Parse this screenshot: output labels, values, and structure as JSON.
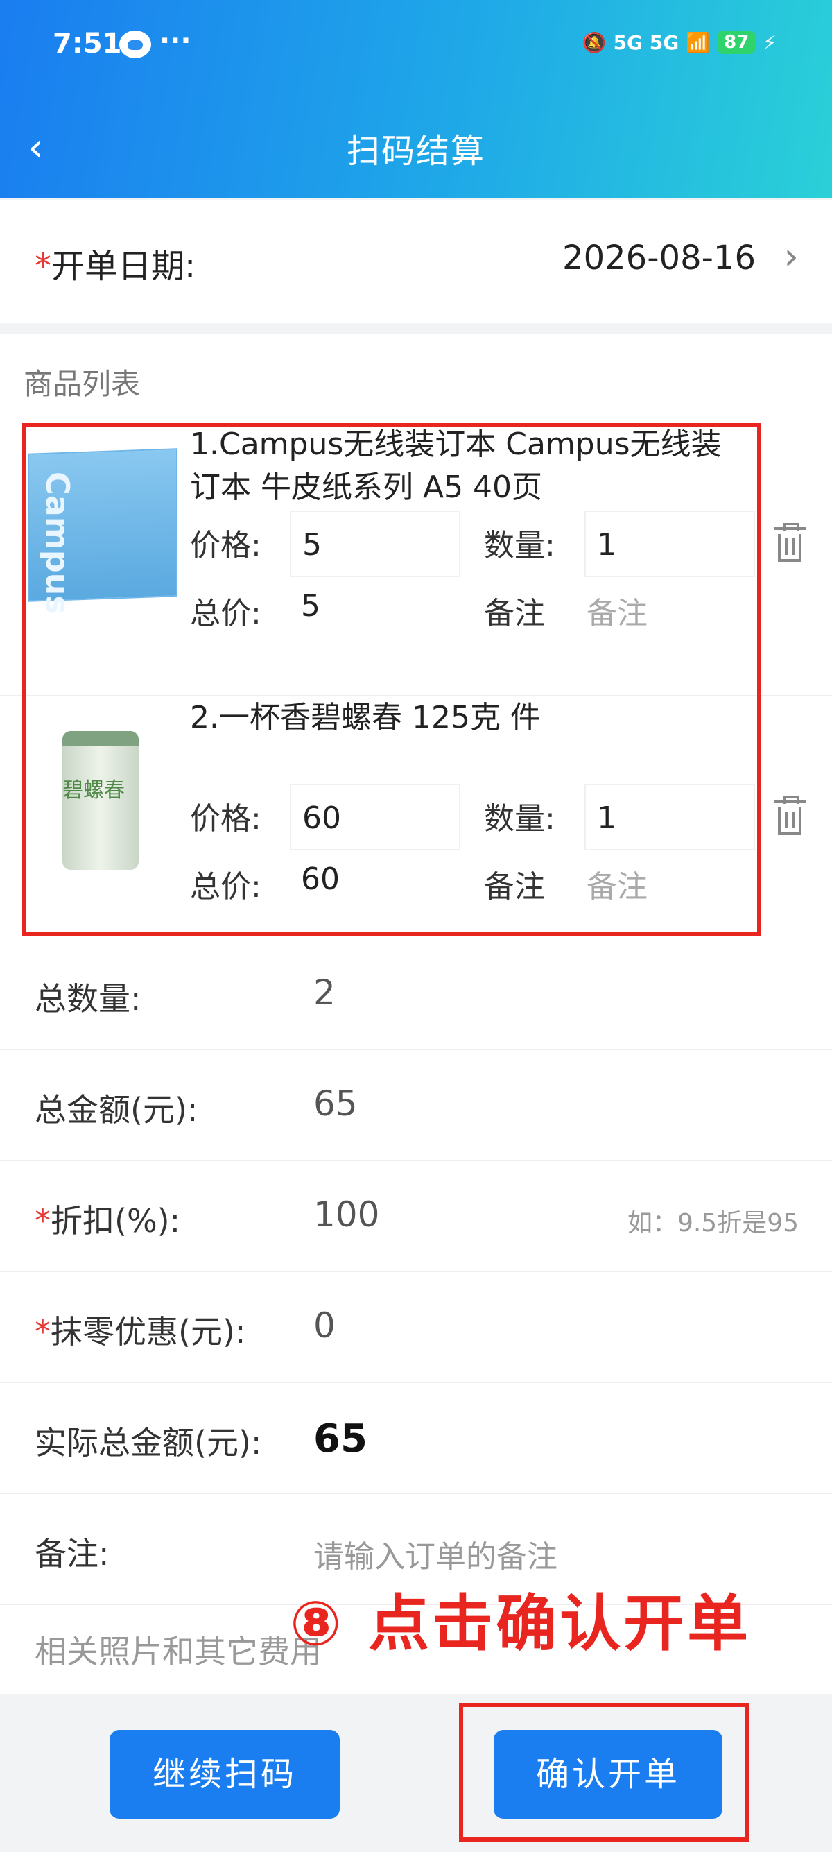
{
  "status_bar": {
    "time": "7:51",
    "dots": "···",
    "network": "5G 5G",
    "battery": "87"
  },
  "nav": {
    "back_icon": "chevron-left-icon",
    "title": "扫码结算"
  },
  "order_date": {
    "label": "开单日期:",
    "required_mark": "*",
    "value": "2026-08-16"
  },
  "goods": {
    "section_title": "商品列表",
    "price_label": "价格:",
    "qty_label": "数量:",
    "total_label": "总价:",
    "remark_label": "备注",
    "remark_placeholder": "备注",
    "items": [
      {
        "name": "1.Campus无线装订本 Campus无线装订本 牛皮纸系列 A5 40页",
        "price": "5",
        "quantity": "1",
        "total": "5",
        "thumb_text": "Campus"
      },
      {
        "name": "2.一杯香碧螺春 125克 件",
        "price": "60",
        "quantity": "1",
        "total": "60",
        "thumb_text": "碧螺春"
      }
    ]
  },
  "summary": {
    "total_qty_label": "总数量:",
    "total_qty": "2",
    "total_amount_label": "总金额(元):",
    "total_amount": "65",
    "discount_label": "折扣(%):",
    "discount": "100",
    "discount_hint": "如：9.5折是95",
    "rounding_label": "抹零优惠(元):",
    "rounding": "0",
    "actual_label": "实际总金额(元):",
    "actual": "65",
    "remark_label": "备注:",
    "remark_placeholder": "请输入订单的备注",
    "photos_label": "相关照片和其它费用"
  },
  "annotation": "⑧ 点击确认开单",
  "footer": {
    "continue_scan": "继续扫码",
    "confirm_order": "确认开单"
  },
  "colors": {
    "primary": "#1a7df0",
    "highlight_red": "#e8261f",
    "required": "#e53935"
  }
}
